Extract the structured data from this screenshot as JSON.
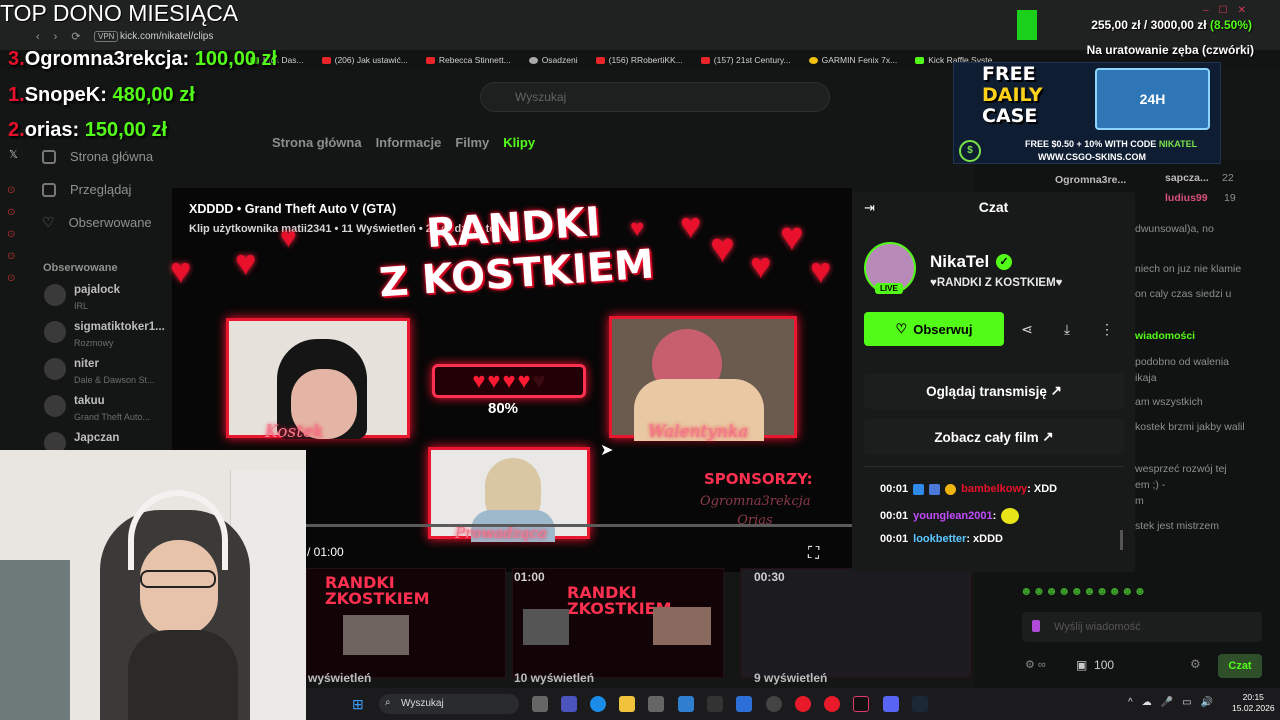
{
  "browser": {
    "url": "kick.com/nikatel/clips",
    "vpn_label": "VPN",
    "bookmarks": [
      "Kick Das...",
      "(206) Jak ustawić...",
      "Rebecca Stinnett...",
      "Osadzeni",
      "(156) RRobertiKK...",
      "(157) 21st Century...",
      "GARMIN Fenix 7x...",
      "Kick Raffle Syste..."
    ]
  },
  "kick": {
    "search_placeholder": "Wyszukaj",
    "tabs": [
      "Strona główna",
      "Informacje",
      "Filmy",
      "Klipy"
    ],
    "active_tab": "Klipy",
    "sidenav": [
      "Strona główna",
      "Przeglądaj",
      "Obserwowane"
    ],
    "following_title": "Obserwowane",
    "following": [
      {
        "name": "pajalock",
        "sub": "IRL"
      },
      {
        "name": "sigmatiktoker1...",
        "sub": "Rozmowy"
      },
      {
        "name": "niter",
        "sub": "Dale & Dawson St..."
      },
      {
        "name": "takuu",
        "sub": "Grand Theft Auto..."
      },
      {
        "name": "Japczan",
        "sub": ""
      }
    ]
  },
  "clip": {
    "title": "XDDDD • Grand Theft Auto V (GTA)",
    "meta": "Klip użytkownika matii2341 • 11 Wyświetleń • 23 godziny temu",
    "overlay_title_1": "RANDKI",
    "overlay_title_2": "Z KOSTKIEM",
    "label_left": "Kostek",
    "label_right": "Walentynka",
    "label_bottom": "Prowadząca",
    "progress_pct": "80%",
    "progress_fraction": 0.8,
    "sponsors_label": "SPONSORZY:",
    "sponsors": [
      "Ogromna3rekcja",
      "Orias"
    ],
    "time": "/ 01:00"
  },
  "thumbnails": [
    {
      "duration": "",
      "views": "wyświetleń"
    },
    {
      "duration": "01:00",
      "views": "10 wyświetleń"
    },
    {
      "duration": "00:30",
      "views": "9 wyświetleń"
    }
  ],
  "popup": {
    "header": "Czat",
    "streamer": "NikaTel",
    "live": "LIVE",
    "stream_title": "♥RANDKI Z KOSTKIEM♥",
    "follow_label": "Obserwuj",
    "watch_label": "Oglądaj transmisję",
    "full_video_label": "Zobacz cały film",
    "messages": [
      {
        "time": "00:01",
        "user": "bambelkowy",
        "text": ": XDD",
        "color": "#e8102a"
      },
      {
        "time": "00:01",
        "user": "younglean2001",
        "text": ":",
        "color": "#c24cff"
      },
      {
        "time": "00:01",
        "user": "lookbetter",
        "text": ": xDDD",
        "color": "#5ac8ff"
      }
    ]
  },
  "right_chat": {
    "users": [
      "Ogromna3re...",
      "sapcza...",
      "ludius99"
    ],
    "counts": [
      "22",
      "19"
    ],
    "lines": [
      "dwunsowal)a, no",
      "niech on juz nie klamie",
      "on caly czas siedzi u",
      "wiadomości",
      "podobno od walenia",
      "ikaja",
      "am wszystkich",
      "kostek brzmi jakby walil",
      "wesprzeć rozwój tej",
      "em ;) -",
      "m",
      "stek jest mistrzem"
    ],
    "input_placeholder": "Wyślij wiadomość",
    "points": "100",
    "send_label": "Czat"
  },
  "overlay": {
    "top_title": "TOP DONO MIESIĄCA",
    "donors": [
      {
        "rank": "3.",
        "name": "Ogromna3rekcja:",
        "amount": "100,00 zł"
      },
      {
        "rank": "1.",
        "name": "SnopeK:",
        "amount": "480,00 zł"
      },
      {
        "rank": "2.",
        "name": "orias:",
        "amount": "150,00 zł"
      }
    ],
    "goal": "255,00 zł / 3000,00 zł",
    "goal_pct": "(8.50%)",
    "goal_label": "Na uratowanie zęba (czwórki)",
    "ad_line1": "FREE",
    "ad_line2": "DAILY",
    "ad_line3": "CASE",
    "ad_crate": "24H",
    "ad_bottom_a": "FREE $0.50 + 10% WITH CODE",
    "ad_bottom_b": "NIKATEL",
    "ad_url": "WWW.CSGO-SKINS.COM"
  },
  "taskbar": {
    "search": "Wyszukaj",
    "time": "20:15",
    "date": "15.02.2026"
  }
}
